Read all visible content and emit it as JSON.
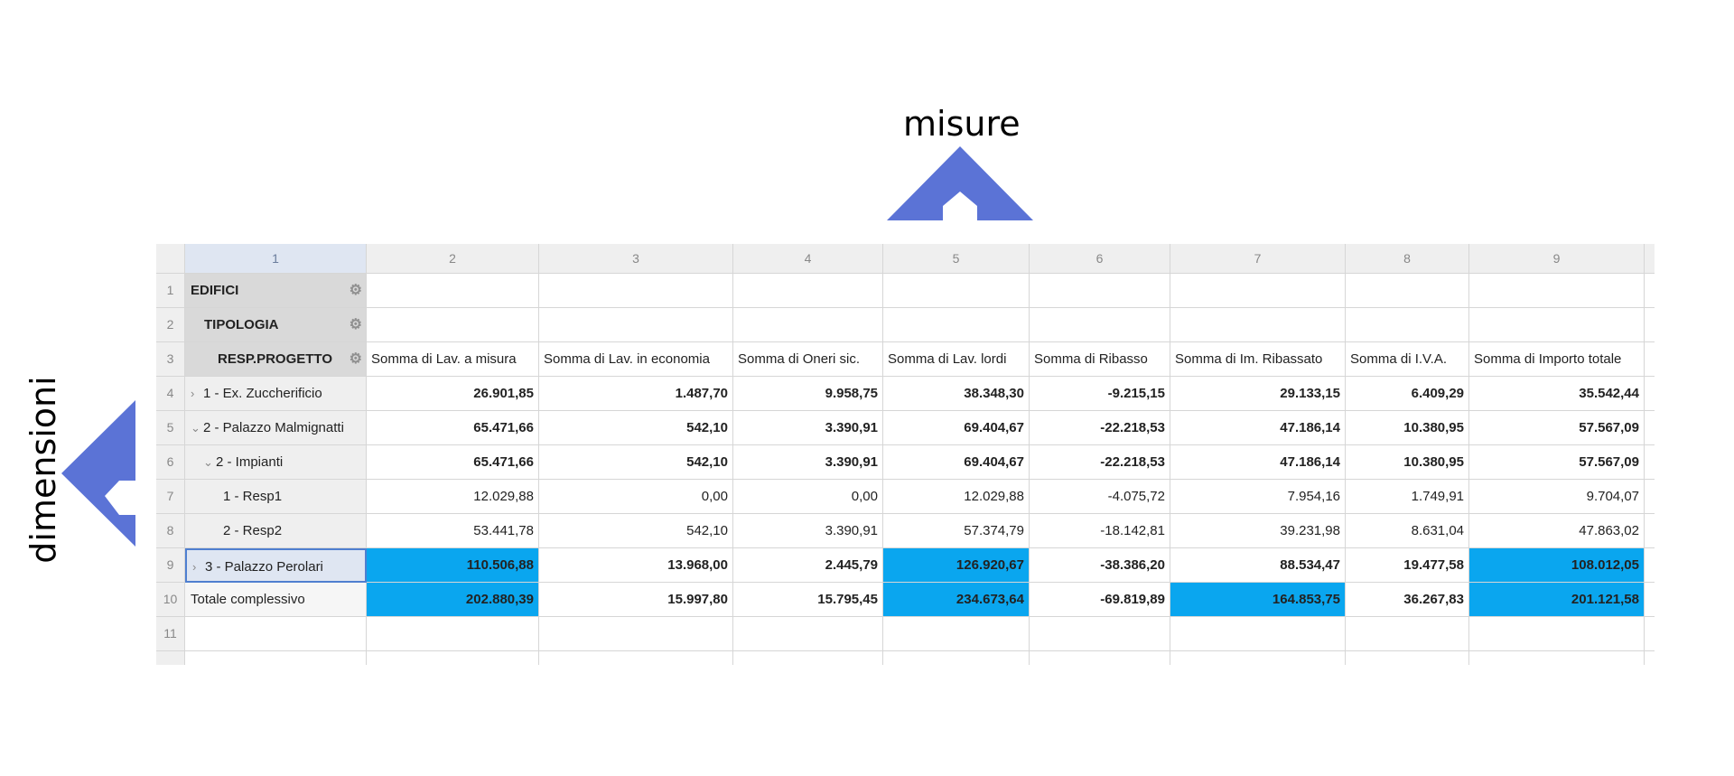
{
  "annotations": {
    "top": "misure",
    "left": "dimensioni"
  },
  "colors": {
    "arrow": "#5b73d6",
    "highlight": "#0aa6ef"
  },
  "columns": [
    "1",
    "2",
    "3",
    "4",
    "5",
    "6",
    "7",
    "8",
    "9"
  ],
  "row_numbers": [
    "1",
    "2",
    "3",
    "4",
    "5",
    "6",
    "7",
    "8",
    "9",
    "10",
    "11"
  ],
  "fields": [
    {
      "label": "EDIFICI",
      "icon": "gear-icon"
    },
    {
      "label": "TIPOLOGIA",
      "icon": "gear-icon"
    },
    {
      "label": "RESP.PROGETTO",
      "icon": "gear-icon"
    }
  ],
  "measures": [
    "Somma di Lav. a misura",
    "Somma di Lav. in economia",
    "Somma di Oneri sic.",
    "Somma di Lav. lordi",
    "Somma di Ribasso",
    "Somma di Im. Ribassato",
    "Somma di I.V.A.",
    "Somma di Importo totale"
  ],
  "rows": [
    {
      "label": "1 - Ex. Zuccherificio",
      "toggle": "›",
      "indent": 0,
      "bold": true,
      "selected": false,
      "values": [
        "26.901,85",
        "1.487,70",
        "9.958,75",
        "38.348,30",
        "-9.215,15",
        "29.133,15",
        "6.409,29",
        "35.542,44"
      ],
      "highlight": []
    },
    {
      "label": "2 - Palazzo Malmignatti",
      "toggle": "⌄",
      "indent": 0,
      "bold": true,
      "selected": false,
      "values": [
        "65.471,66",
        "542,10",
        "3.390,91",
        "69.404,67",
        "-22.218,53",
        "47.186,14",
        "10.380,95",
        "57.567,09"
      ],
      "highlight": []
    },
    {
      "label": "2 - Impianti",
      "toggle": "⌄",
      "indent": 1,
      "bold": true,
      "selected": false,
      "values": [
        "65.471,66",
        "542,10",
        "3.390,91",
        "69.404,67",
        "-22.218,53",
        "47.186,14",
        "10.380,95",
        "57.567,09"
      ],
      "highlight": []
    },
    {
      "label": "1 - Resp1",
      "toggle": "",
      "indent": 2,
      "bold": false,
      "selected": false,
      "values": [
        "12.029,88",
        "0,00",
        "0,00",
        "12.029,88",
        "-4.075,72",
        "7.954,16",
        "1.749,91",
        "9.704,07"
      ],
      "highlight": []
    },
    {
      "label": "2 - Resp2",
      "toggle": "",
      "indent": 2,
      "bold": false,
      "selected": false,
      "values": [
        "53.441,78",
        "542,10",
        "3.390,91",
        "57.374,79",
        "-18.142,81",
        "39.231,98",
        "8.631,04",
        "47.863,02"
      ],
      "highlight": []
    },
    {
      "label": "3 - Palazzo Perolari",
      "toggle": "›",
      "indent": 0,
      "bold": true,
      "selected": true,
      "values": [
        "110.506,88",
        "13.968,00",
        "2.445,79",
        "126.920,67",
        "-38.386,20",
        "88.534,47",
        "19.477,58",
        "108.012,05"
      ],
      "highlight": [
        0,
        3,
        7
      ]
    },
    {
      "label": "Totale complessivo",
      "toggle": "",
      "indent": 0,
      "bold": true,
      "selected": false,
      "plain_label": true,
      "values": [
        "202.880,39",
        "15.997,80",
        "15.795,45",
        "234.673,64",
        "-69.819,89",
        "164.853,75",
        "36.267,83",
        "201.121,58"
      ],
      "highlight": [
        0,
        3,
        5,
        7
      ]
    }
  ]
}
